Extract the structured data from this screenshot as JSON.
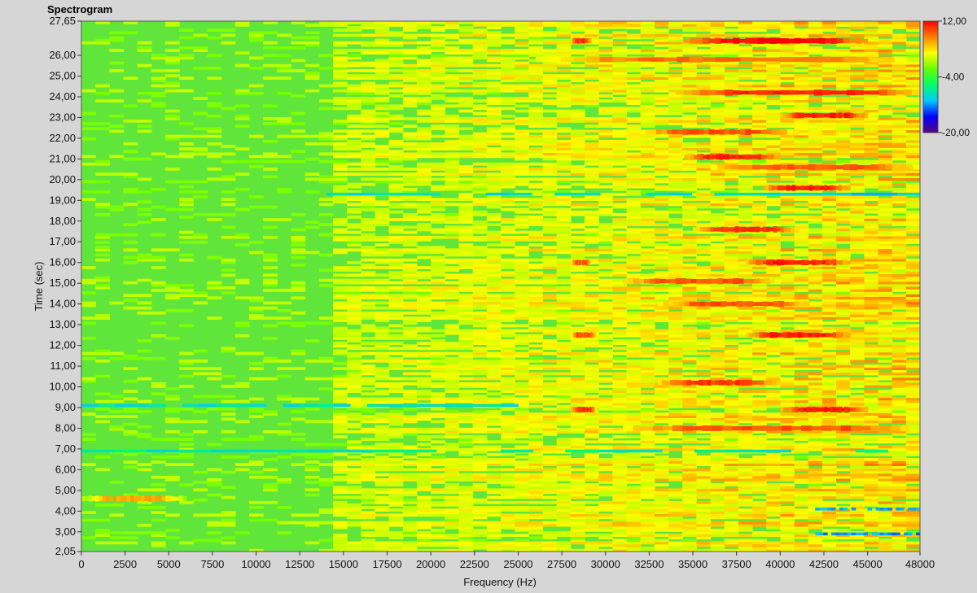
{
  "chart_data": {
    "type": "heatmap",
    "title": "Spectrogram",
    "xlabel": "Frequency (Hz)",
    "ylabel": "Time (sec)",
    "xlim": [
      0,
      48000
    ],
    "ylim": [
      2.05,
      27.65
    ],
    "x_ticks": [
      0,
      2500,
      5000,
      7500,
      10000,
      12500,
      15000,
      17500,
      20000,
      22500,
      25000,
      27500,
      30000,
      32500,
      35000,
      37500,
      40000,
      42500,
      45000,
      48000
    ],
    "x_tick_labels": [
      "0",
      "2500",
      "5000",
      "7500",
      "10000",
      "12500",
      "15000",
      "17500",
      "20000",
      "22500",
      "25000",
      "27500",
      "30000",
      "32500",
      "35000",
      "37500",
      "40000",
      "42500",
      "45000",
      "48000"
    ],
    "y_ticks": [
      2.05,
      3,
      4,
      5,
      6,
      7,
      8,
      9,
      10,
      11,
      12,
      13,
      14,
      15,
      16,
      17,
      18,
      19,
      20,
      21,
      22,
      23,
      24,
      25,
      26,
      27.65
    ],
    "y_tick_labels": [
      "2,05",
      "3,00",
      "4,00",
      "5,00",
      "6,00",
      "7,00",
      "8,00",
      "9,00",
      "10,00",
      "11,00",
      "12,00",
      "13,00",
      "14,00",
      "15,00",
      "16,00",
      "17,00",
      "18,00",
      "19,00",
      "20,00",
      "21,00",
      "22,00",
      "23,00",
      "24,00",
      "25,00",
      "26,00",
      "27,65"
    ],
    "colorbar": {
      "min": -20,
      "max": 12,
      "ticks": [
        12,
        -4,
        -20
      ],
      "tick_labels": [
        "12,00",
        "-4,00",
        "-20,00"
      ],
      "colors": [
        "#5a0080",
        "#0000ff",
        "#00c8ff",
        "#00ff66",
        "#66ff00",
        "#ffff00",
        "#ff8000",
        "#ff0000"
      ]
    },
    "grid": false,
    "background_level": -4,
    "high_energy_events": [
      {
        "time": 26.7,
        "freq_start": 34500,
        "freq_end": 45000,
        "level": 12
      },
      {
        "time": 26.7,
        "freq_start": 28000,
        "freq_end": 29200,
        "level": 10
      },
      {
        "time": 25.8,
        "freq_start": 26000,
        "freq_end": 48000,
        "level": 8
      },
      {
        "time": 24.2,
        "freq_start": 34000,
        "freq_end": 48000,
        "level": 11
      },
      {
        "time": 23.1,
        "freq_start": 40000,
        "freq_end": 45000,
        "level": 11
      },
      {
        "time": 22.3,
        "freq_start": 32000,
        "freq_end": 41000,
        "level": 9
      },
      {
        "time": 21.1,
        "freq_start": 34500,
        "freq_end": 40000,
        "level": 11
      },
      {
        "time": 20.6,
        "freq_start": 36000,
        "freq_end": 48000,
        "level": 9
      },
      {
        "time": 19.6,
        "freq_start": 39000,
        "freq_end": 44000,
        "level": 11
      },
      {
        "time": 17.6,
        "freq_start": 35000,
        "freq_end": 41000,
        "level": 10
      },
      {
        "time": 16.0,
        "freq_start": 38000,
        "freq_end": 44000,
        "level": 11
      },
      {
        "time": 16.0,
        "freq_start": 28000,
        "freq_end": 29200,
        "level": 9
      },
      {
        "time": 15.1,
        "freq_start": 31000,
        "freq_end": 40000,
        "level": 9
      },
      {
        "time": 14.0,
        "freq_start": 33000,
        "freq_end": 42000,
        "level": 9
      },
      {
        "time": 12.5,
        "freq_start": 38000,
        "freq_end": 44000,
        "level": 11
      },
      {
        "time": 12.5,
        "freq_start": 28000,
        "freq_end": 29500,
        "level": 9
      },
      {
        "time": 10.2,
        "freq_start": 33000,
        "freq_end": 40000,
        "level": 10
      },
      {
        "time": 8.9,
        "freq_start": 40000,
        "freq_end": 45000,
        "level": 11
      },
      {
        "time": 8.9,
        "freq_start": 28000,
        "freq_end": 29500,
        "level": 10
      },
      {
        "time": 8.0,
        "freq_start": 31000,
        "freq_end": 48000,
        "level": 9
      },
      {
        "time": 4.6,
        "freq_start": 0,
        "freq_end": 6000,
        "level": 6
      }
    ],
    "low_energy_bands": [
      {
        "time": 19.3,
        "freq_start": 14000,
        "freq_end": 48000,
        "level": -10
      },
      {
        "time": 9.1,
        "freq_start": 0,
        "freq_end": 25000,
        "level": -9
      },
      {
        "time": 6.9,
        "freq_start": 0,
        "freq_end": 48000,
        "level": -8
      },
      {
        "time": 4.1,
        "freq_start": 42000,
        "freq_end": 48000,
        "level": -11
      },
      {
        "time": 2.9,
        "freq_start": 42000,
        "freq_end": 48000,
        "level": -12
      }
    ]
  }
}
